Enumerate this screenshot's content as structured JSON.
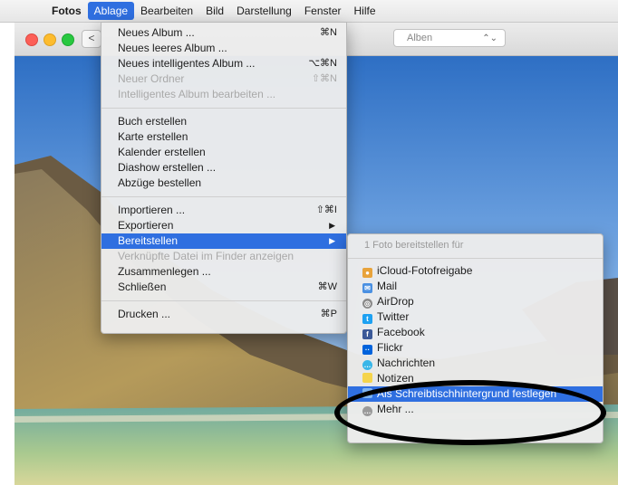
{
  "menubar": {
    "apple": "",
    "app_name": "Fotos",
    "items": [
      "Ablage",
      "Bearbeiten",
      "Bild",
      "Darstellung",
      "Fenster",
      "Hilfe"
    ]
  },
  "window": {
    "back": "<",
    "view_select": "Alben",
    "view_select_arrows": "⌃⌄"
  },
  "file_menu": {
    "groups": [
      [
        {
          "label": "Neues Album ...",
          "shortcut": "⌘N",
          "enabled": true
        },
        {
          "label": "Neues leeres Album ...",
          "shortcut": "",
          "enabled": true
        },
        {
          "label": "Neues intelligentes Album ...",
          "shortcut": "⌥⌘N",
          "enabled": true
        },
        {
          "label": "Neuer Ordner",
          "shortcut": "⇧⌘N",
          "enabled": false
        },
        {
          "label": "Intelligentes Album bearbeiten ...",
          "shortcut": "",
          "enabled": false
        }
      ],
      [
        {
          "label": "Buch erstellen",
          "enabled": true
        },
        {
          "label": "Karte erstellen",
          "enabled": true
        },
        {
          "label": "Kalender erstellen",
          "enabled": true
        },
        {
          "label": "Diashow erstellen ...",
          "enabled": true
        },
        {
          "label": "Abzüge bestellen",
          "enabled": true
        }
      ],
      [
        {
          "label": "Importieren ...",
          "shortcut": "⇧⌘I",
          "enabled": true
        },
        {
          "label": "Exportieren",
          "submenu": true,
          "enabled": true
        },
        {
          "label": "Bereitstellen",
          "submenu": true,
          "enabled": true,
          "highlighted": true
        },
        {
          "label": "Verknüpfte Datei im Finder anzeigen",
          "enabled": false
        },
        {
          "label": "Zusammenlegen ...",
          "enabled": true
        },
        {
          "label": "Schließen",
          "shortcut": "⌘W",
          "enabled": true
        }
      ],
      [
        {
          "label": "Drucken ...",
          "shortcut": "⌘P",
          "enabled": true
        }
      ]
    ]
  },
  "share_menu": {
    "header": "1 Foto bereitstellen für",
    "items": [
      {
        "label": "iCloud-Fotofreigabe",
        "icon": "icloud-photo-sharing-icon",
        "color": "#e8a33b"
      },
      {
        "label": "Mail",
        "icon": "mail-icon",
        "color": "#4a90e2"
      },
      {
        "label": "AirDrop",
        "icon": "airdrop-icon",
        "color": "#8a8a8a"
      },
      {
        "label": "Twitter",
        "icon": "twitter-icon",
        "color": "#1da1f2"
      },
      {
        "label": "Facebook",
        "icon": "facebook-icon",
        "color": "#3b5998"
      },
      {
        "label": "Flickr",
        "icon": "flickr-icon",
        "color": "#0063dc"
      },
      {
        "label": "Nachrichten",
        "icon": "messages-icon",
        "color": "#38b6e8"
      },
      {
        "label": "Notizen",
        "icon": "notes-icon",
        "color": "#f5d44b"
      },
      {
        "label": "Als Schreibtischhintergrund festlegen",
        "icon": "desktop-picture-icon",
        "color": "#4a90e2",
        "highlighted": true
      },
      {
        "label": "Mehr ...",
        "icon": "more-icon",
        "color": "#9a9a9a"
      }
    ]
  },
  "colors": {
    "highlight": "#2f6fe0",
    "annotation": "#000000"
  }
}
